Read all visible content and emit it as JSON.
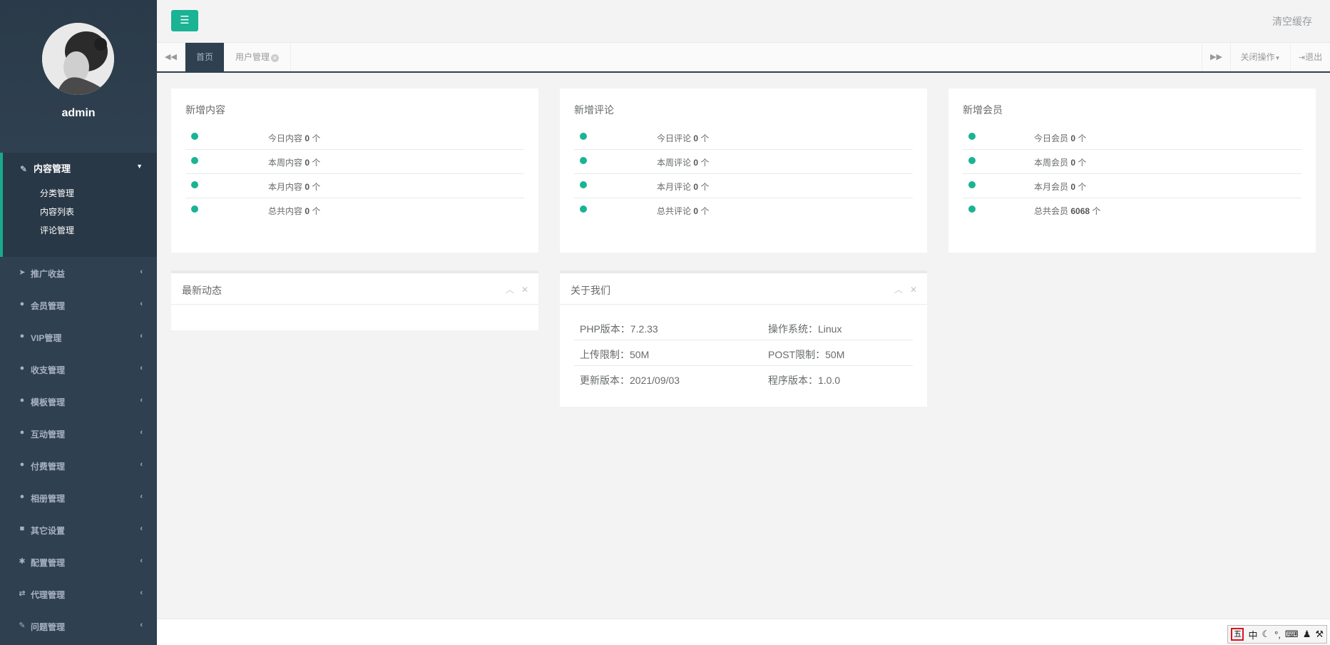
{
  "sidebar": {
    "username": "admin",
    "active_section": {
      "label": "内容管理",
      "icon": "edit-icon",
      "sub_items": [
        "分类管理",
        "内容列表",
        "评论管理"
      ]
    },
    "items": [
      {
        "label": "推广收益",
        "icon": "paper-plane-icon"
      },
      {
        "label": "会员管理",
        "icon": "user-icon"
      },
      {
        "label": "VIP管理",
        "icon": "user-icon"
      },
      {
        "label": "收支管理",
        "icon": "user-icon"
      },
      {
        "label": "模板管理",
        "icon": "user-icon"
      },
      {
        "label": "互动管理",
        "icon": "user-icon"
      },
      {
        "label": "付费管理",
        "icon": "user-icon"
      },
      {
        "label": "相册管理",
        "icon": "user-icon"
      },
      {
        "label": "其它设置",
        "icon": "book-icon"
      },
      {
        "label": "配置管理",
        "icon": "asterisk-icon"
      },
      {
        "label": "代理管理",
        "icon": "exchange-icon"
      },
      {
        "label": "问题管理",
        "icon": "edit-icon"
      }
    ]
  },
  "header": {
    "menu_icon": "bars-icon",
    "clear_cache": "清空缓存"
  },
  "tabs": {
    "home": "首页",
    "user_mgmt": "用户管理",
    "close_ops": "关闭操作",
    "logout": "退出"
  },
  "stats": [
    {
      "title": "新增内容",
      "rows": [
        {
          "label": "今日内容",
          "value": "0",
          "unit": "个"
        },
        {
          "label": "本周内容",
          "value": "0",
          "unit": "个"
        },
        {
          "label": "本月内容",
          "value": "0",
          "unit": "个"
        },
        {
          "label": "总共内容",
          "value": "0",
          "unit": "个"
        }
      ]
    },
    {
      "title": "新增评论",
      "rows": [
        {
          "label": "今日评论",
          "value": "0",
          "unit": "个"
        },
        {
          "label": "本周评论",
          "value": "0",
          "unit": "个"
        },
        {
          "label": "本月评论",
          "value": "0",
          "unit": "个"
        },
        {
          "label": "总共评论",
          "value": "0",
          "unit": "个"
        }
      ]
    },
    {
      "title": "新增会员",
      "rows": [
        {
          "label": "今日会员",
          "value": "0",
          "unit": "个"
        },
        {
          "label": "本周会员",
          "value": "0",
          "unit": "个"
        },
        {
          "label": "本月会员",
          "value": "0",
          "unit": "个"
        },
        {
          "label": "总共会员",
          "value": "6068",
          "unit": "个"
        }
      ]
    }
  ],
  "latest_panel": {
    "title": "最新动态"
  },
  "about_panel": {
    "title": "关于我们",
    "rows": [
      {
        "left": "PHP版本：7.2.33",
        "right": "操作系统：Linux"
      },
      {
        "left": "上传限制：50M",
        "right": "POST限制：50M"
      },
      {
        "left": "更新版本：2021/09/03",
        "right": "程序版本：1.0.0"
      }
    ]
  },
  "ime_toolbar": {
    "mode_char": "五",
    "lang": "中"
  },
  "colors": {
    "sidebar": "#2f4050",
    "accent": "#1ab394"
  }
}
